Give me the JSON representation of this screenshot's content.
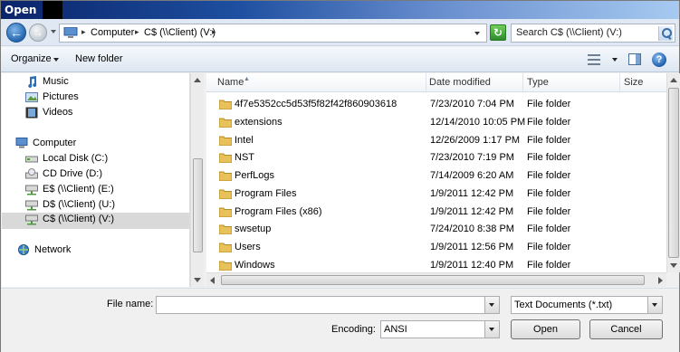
{
  "window": {
    "title": "Open"
  },
  "address": {
    "segments": [
      "Computer",
      "C$ (\\\\Client) (V:)"
    ]
  },
  "search": {
    "placeholder": "Search C$ (\\\\Client) (V:)"
  },
  "toolbar": {
    "organize": "Organize",
    "new_folder": "New folder"
  },
  "sidebar": {
    "items": [
      {
        "label": "Music",
        "icon": "music-icon"
      },
      {
        "label": "Pictures",
        "icon": "pictures-icon"
      },
      {
        "label": "Videos",
        "icon": "videos-icon"
      },
      {
        "label": "Computer",
        "icon": "computer-icon"
      },
      {
        "label": "Local Disk (C:)",
        "icon": "drive-icon"
      },
      {
        "label": "CD Drive (D:)",
        "icon": "cd-drive-icon"
      },
      {
        "label": "E$ (\\\\Client) (E:)",
        "icon": "network-drive-icon"
      },
      {
        "label": "D$ (\\\\Client) (U:)",
        "icon": "network-drive-icon"
      },
      {
        "label": "C$ (\\\\Client) (V:)",
        "icon": "network-drive-icon",
        "selected": true
      },
      {
        "label": "Network",
        "icon": "network-icon"
      }
    ]
  },
  "columns": [
    "Name",
    "Date modified",
    "Type",
    "Size"
  ],
  "files": [
    {
      "name": "4f7e5352cc5d53f5f82f42f860903618",
      "date": "7/23/2010 7:04 PM",
      "type": "File folder"
    },
    {
      "name": "extensions",
      "date": "12/14/2010 10:05 PM",
      "type": "File folder"
    },
    {
      "name": "Intel",
      "date": "12/26/2009 1:17 PM",
      "type": "File folder"
    },
    {
      "name": "NST",
      "date": "7/23/2010 7:19 PM",
      "type": "File folder"
    },
    {
      "name": "PerfLogs",
      "date": "7/14/2009 6:20 AM",
      "type": "File folder"
    },
    {
      "name": "Program Files",
      "date": "1/9/2011 12:42 PM",
      "type": "File folder"
    },
    {
      "name": "Program Files (x86)",
      "date": "1/9/2011 12:42 PM",
      "type": "File folder"
    },
    {
      "name": "swsetup",
      "date": "7/24/2010 8:38 PM",
      "type": "File folder"
    },
    {
      "name": "Users",
      "date": "1/9/2011 12:56 PM",
      "type": "File folder"
    },
    {
      "name": "Windows",
      "date": "1/9/2011 12:40 PM",
      "type": "File folder"
    }
  ],
  "bottom": {
    "file_name_label": "File name:",
    "file_name_value": "",
    "filter_value": "Text Documents (*.txt)",
    "encoding_label": "Encoding:",
    "encoding_value": "ANSI",
    "open_label": "Open",
    "cancel_label": "Cancel"
  },
  "colors": {
    "folder": "#e8c15a",
    "selected_row": "#d9d9d9",
    "title_dark": "#0a246a"
  }
}
